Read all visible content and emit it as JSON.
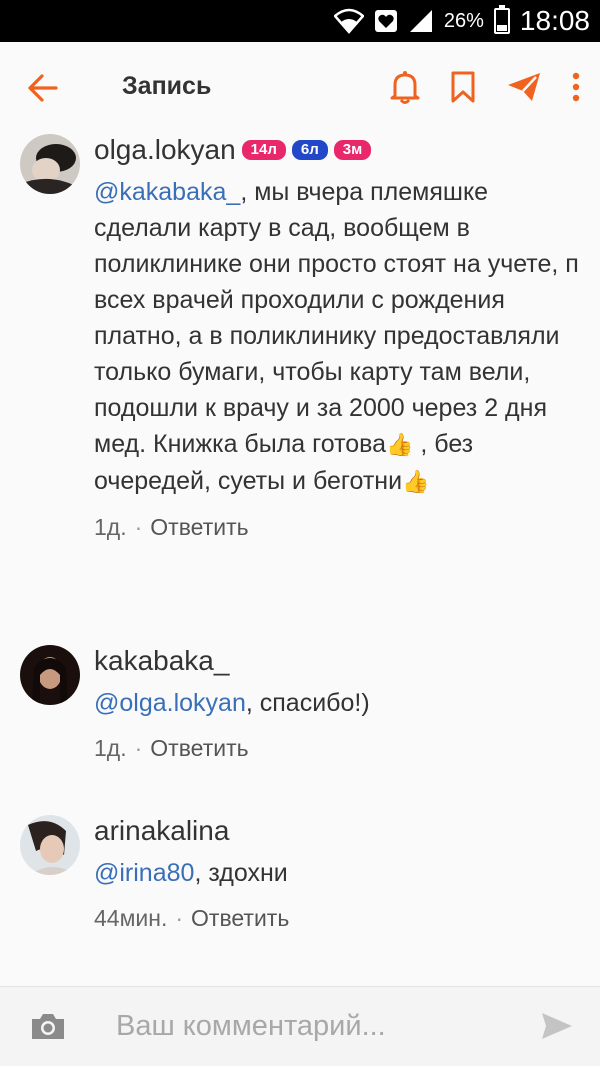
{
  "status": {
    "battery_text": "26%",
    "battery_level": 0.26,
    "time": "18:08"
  },
  "appbar": {
    "title": "Запись",
    "icons": [
      "back-arrow-icon",
      "bell-icon",
      "bookmark-icon",
      "send-plane-icon",
      "more-vert-icon"
    ]
  },
  "colors": {
    "accent": "#f0631e",
    "mention": "#3a6fb7",
    "badge_pink": "#e8286b",
    "badge_blue": "#2247c9"
  },
  "comments": [
    {
      "username": "olga.lokyan",
      "badges": [
        "14л",
        "6л",
        "3м"
      ],
      "mention": "@kakabaka_",
      "text_1": ", мы вчера племяшке сделали карту в сад, вообщем в поликлинике они просто стоят на учете, п всех врачей проходили с рождения платно, а в поликлинику предоставляли только бумаги, чтобы карту там вели, подошли к врачу и за 2000 через 2 дня мед. Книжка была готова",
      "text_2": " , без очередей, суеты и беготни",
      "emoji": "👍",
      "time": "1д.",
      "dot": "·",
      "reply": "Ответить"
    },
    {
      "username": "kakabaka_",
      "mention": "@olga.lokyan",
      "text": ", спасибо!)",
      "time": "1д.",
      "dot": "·",
      "reply": "Ответить"
    },
    {
      "username": "arinakalina",
      "mention": "@irina80",
      "text": ", здохни",
      "time": "44мин.",
      "dot": "·",
      "reply": "Ответить"
    }
  ],
  "input": {
    "placeholder": "Ваш комментарий...",
    "value": ""
  }
}
